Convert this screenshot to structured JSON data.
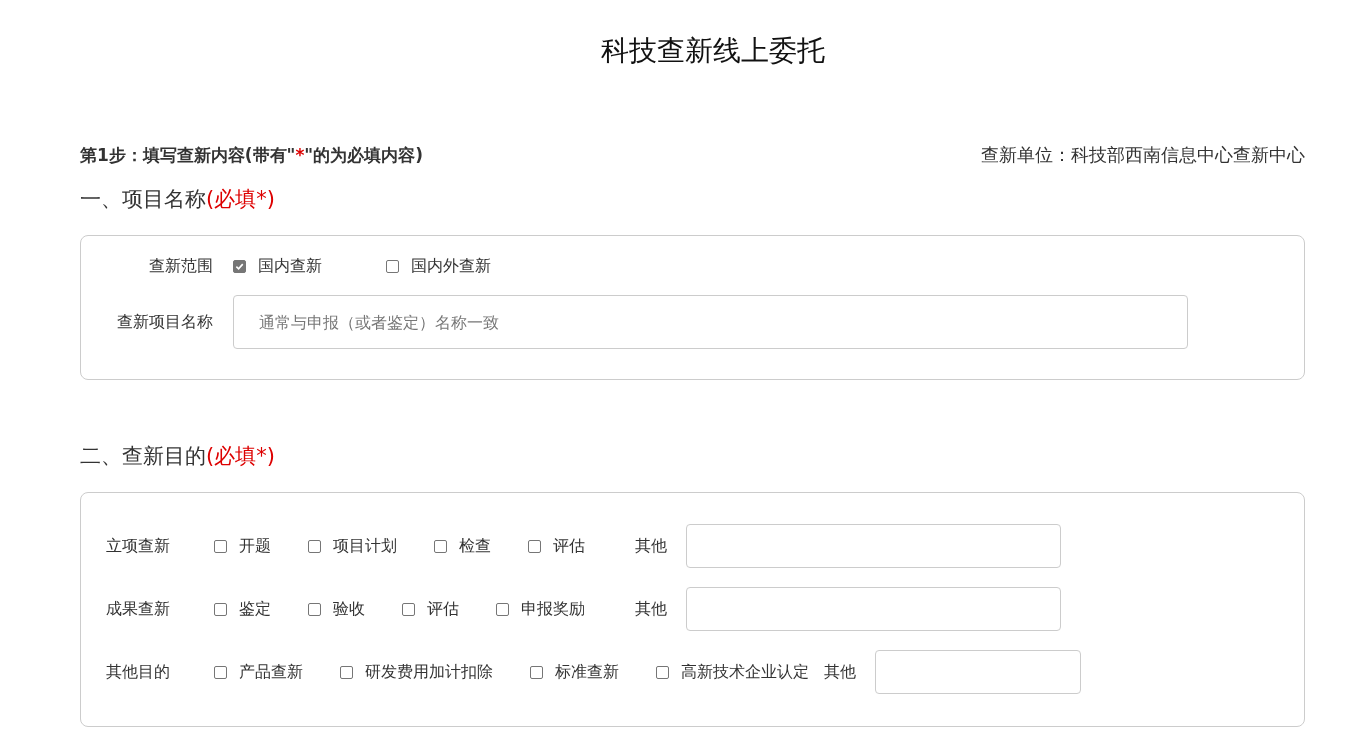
{
  "page_title": "科技查新线上委托",
  "step": {
    "before": "第1步：填写查新内容(带有\"",
    "mark": "*",
    "after": "\"的为必填内容)"
  },
  "unit": "查新单位：科技部西南信息中心查新中心",
  "sections": [
    {
      "title": "一、项目名称",
      "required": "(必填*)",
      "kind": "name",
      "scope": {
        "label": "查新范围",
        "options": [
          {
            "label": "国内查新",
            "checked": true
          },
          {
            "label": "国内外查新",
            "checked": false
          }
        ]
      },
      "name_field": {
        "label": "查新项目名称",
        "placeholder": "通常与申报（或者鉴定）名称一致"
      }
    },
    {
      "title": "二、查新目的",
      "required": "(必填*)",
      "kind": "purpose",
      "rows": [
        {
          "label": "立项查新",
          "options": [
            {
              "label": "开题",
              "checked": false
            },
            {
              "label": "项目计划",
              "checked": false
            },
            {
              "label": "检查",
              "checked": false
            },
            {
              "label": "评估",
              "checked": false
            }
          ],
          "other": "其他"
        },
        {
          "label": "成果查新",
          "options": [
            {
              "label": "鉴定",
              "checked": false
            },
            {
              "label": "验收",
              "checked": false
            },
            {
              "label": "评估",
              "checked": false
            },
            {
              "label": "申报奖励",
              "checked": false
            }
          ],
          "other": "其他"
        },
        {
          "label": "其他目的",
          "options": [
            {
              "label": "产品查新",
              "checked": false
            },
            {
              "label": "研发费用加计扣除",
              "checked": false
            },
            {
              "label": "标准查新",
              "checked": false
            },
            {
              "label": "高新技术企业认定",
              "checked": false
            }
          ],
          "other": "其他"
        }
      ]
    }
  ]
}
